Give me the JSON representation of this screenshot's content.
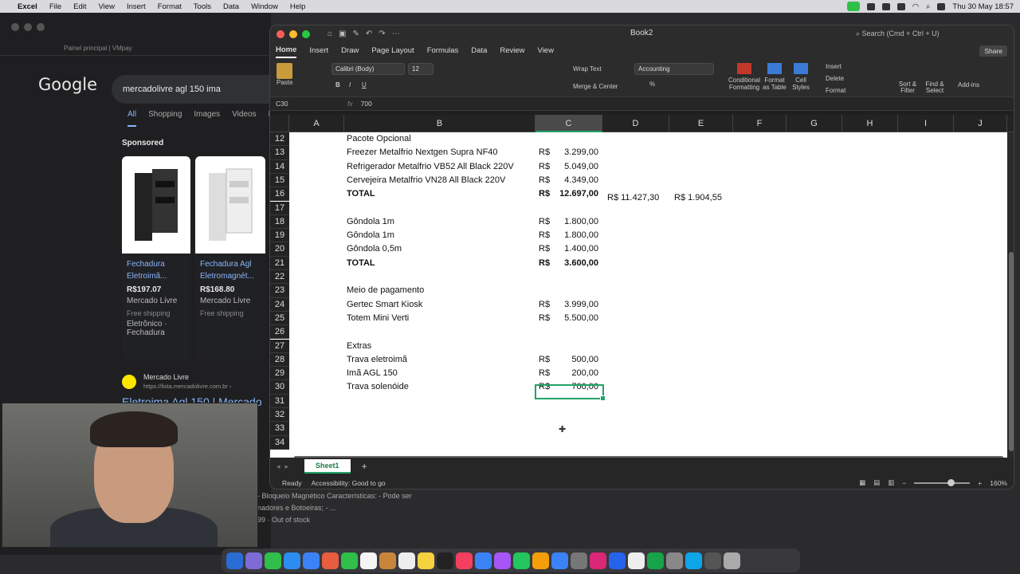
{
  "menubar": {
    "app": "Excel",
    "items": [
      "File",
      "Edit",
      "View",
      "Insert",
      "Format",
      "Tools",
      "Data",
      "Window",
      "Help"
    ],
    "clock": "Thu 30 May  18:57"
  },
  "browser": {
    "tab_title": "Painel principal | VMpay",
    "search_query": "mercadolivre agl 150 ima",
    "tabs": [
      "All",
      "Shopping",
      "Images",
      "Videos",
      "Ne"
    ],
    "sponsored": "Sponsored",
    "products": [
      {
        "title": "Fechadura Eletroimã...",
        "price": "R$197.07",
        "store": "Mercado Livre",
        "shipping": "Free shipping",
        "category": "Eletrônico · Fechadura"
      },
      {
        "title": "Fechadura Agl Eletromagnét...",
        "price": "R$168.80",
        "store": "Mercado Livre",
        "shipping": "Free shipping",
        "category": ""
      }
    ],
    "result": {
      "site": "Mercado Livre",
      "url": "https://lista.mercadolivre.com.br ›",
      "link": "Eletroima Agl 150 | Mercado"
    },
    "snippets": [
      "- Bloqueio Magnético Características: - Pode ser",
      "nadores e Botoeiras; - ...",
      "99 · Out of stock"
    ]
  },
  "excel": {
    "title": "Book2",
    "search_placeholder": "Search (Cmd + Ctrl + U)",
    "tabs": [
      "Home",
      "Insert",
      "Draw",
      "Page Layout",
      "Formulas",
      "Data",
      "Review",
      "View"
    ],
    "share": "Share",
    "ribbon": {
      "paste": "Paste",
      "font": "Calibri (Body)",
      "size": "12",
      "wrap": "Wrap Text",
      "merge": "Merge & Center",
      "number_format": "Accounting",
      "cond": "Conditional Formatting",
      "table": "Format as Table",
      "styles": "Cell Styles",
      "insert": "Insert",
      "delete": "Delete",
      "format": "Format",
      "sort": "Sort & Filter",
      "find": "Find & Select",
      "addins": "Add-ins"
    },
    "name_box": "C30",
    "formula": "700",
    "columns": [
      "A",
      "B",
      "C",
      "D",
      "E",
      "F",
      "G",
      "H",
      "I",
      "J"
    ],
    "rows": [
      {
        "n": "12",
        "b": "Pacote Opcional",
        "cur": "",
        "amt": "",
        "bold": false
      },
      {
        "n": "13",
        "b": "Freezer Metalfrio Nextgen Supra NF40",
        "cur": "R$",
        "amt": "3.299,00",
        "bold": false
      },
      {
        "n": "14",
        "b": "Refrigerador Metalfrio VB52 All Black 220V",
        "cur": "R$",
        "amt": "5.049,00",
        "bold": false
      },
      {
        "n": "15",
        "b": "Cervejeira Metalfrio VN28 All Black 220V",
        "cur": "R$",
        "amt": "4.349,00",
        "bold": false
      },
      {
        "n": "16",
        "b": "TOTAL",
        "cur": "R$",
        "amt": "12.697,00",
        "bold": true
      },
      {
        "n": "17",
        "b": "",
        "cur": "",
        "amt": "",
        "bold": false
      },
      {
        "n": "18",
        "b": "Gôndola 1m",
        "cur": "R$",
        "amt": "1.800,00",
        "bold": false
      },
      {
        "n": "19",
        "b": "Gôndola 1m",
        "cur": "R$",
        "amt": "1.800,00",
        "bold": false
      },
      {
        "n": "20",
        "b": "Gôndola 0,5m",
        "cur": "R$",
        "amt": "1.400,00",
        "bold": false
      },
      {
        "n": "21",
        "b": "TOTAL",
        "cur": "R$",
        "amt": "3.600,00",
        "bold": true
      },
      {
        "n": "22",
        "b": "",
        "cur": "",
        "amt": "",
        "bold": false
      },
      {
        "n": "23",
        "b": "Meio de pagamento",
        "cur": "",
        "amt": "",
        "bold": false
      },
      {
        "n": "24",
        "b": "Gertec Smart Kiosk",
        "cur": "R$",
        "amt": "3.999,00",
        "bold": false
      },
      {
        "n": "25",
        "b": "Totem Mini Verti",
        "cur": "R$",
        "amt": "5.500,00",
        "bold": false
      },
      {
        "n": "26",
        "b": "",
        "cur": "",
        "amt": "",
        "bold": false
      },
      {
        "n": "27",
        "b": "Extras",
        "cur": "",
        "amt": "",
        "bold": false
      },
      {
        "n": "28",
        "b": "Trava eletroimã",
        "cur": "R$",
        "amt": "500,00",
        "bold": false
      },
      {
        "n": "29",
        "b": "Imã AGL 150",
        "cur": "R$",
        "amt": "200,00",
        "bold": false
      },
      {
        "n": "30",
        "b": "Trava solenóide",
        "cur": "R$",
        "amt": "700,00",
        "bold": false
      },
      {
        "n": "31",
        "b": "",
        "cur": "",
        "amt": "",
        "bold": false
      },
      {
        "n": "32",
        "b": "",
        "cur": "",
        "amt": "",
        "bold": false
      },
      {
        "n": "33",
        "b": "",
        "cur": "",
        "amt": "",
        "bold": false
      },
      {
        "n": "34",
        "b": "",
        "cur": "",
        "amt": "",
        "bold": false
      }
    ],
    "row16_d": "R$ 11.427,30",
    "row16_e": "R$ 1.904,55",
    "sheet_tab": "Sheet1",
    "status": "Ready",
    "accessibility": "Accessibility: Good to go",
    "zoom": "160%"
  }
}
